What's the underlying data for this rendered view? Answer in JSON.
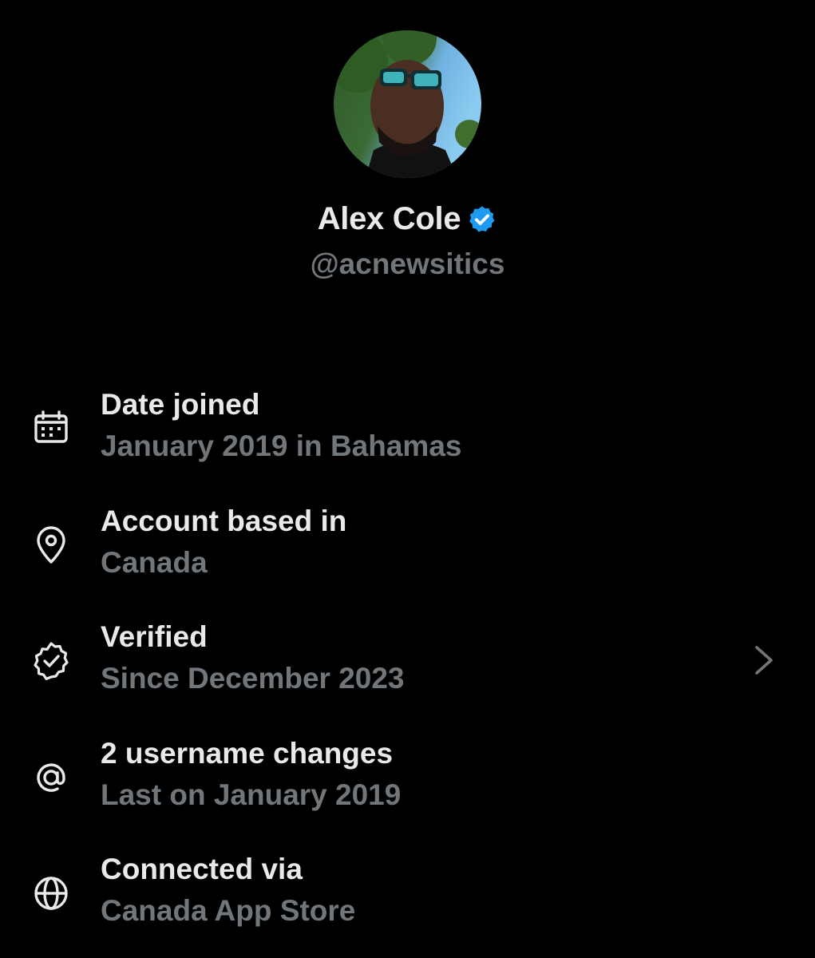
{
  "profile": {
    "display_name": "Alex Cole",
    "handle": "@acnewsitics",
    "verified": true
  },
  "rows": [
    {
      "icon": "calendar-icon",
      "title": "Date joined",
      "subtitle": "January 2019 in Bahamas"
    },
    {
      "icon": "location-pin-icon",
      "title": "Account based in",
      "subtitle": "Canada"
    },
    {
      "icon": "verified-badge-icon",
      "title": "Verified",
      "subtitle": "Since December 2023",
      "has_chevron": true
    },
    {
      "icon": "at-sign-icon",
      "title": "2 username changes",
      "subtitle": "Last on January 2019"
    },
    {
      "icon": "globe-icon",
      "title": "Connected via",
      "subtitle": "Canada App Store"
    }
  ],
  "colors": {
    "background": "#000000",
    "primary_text": "#e7e9ea",
    "secondary_text": "#71767b",
    "verified_blue": "#1d9bf0"
  }
}
